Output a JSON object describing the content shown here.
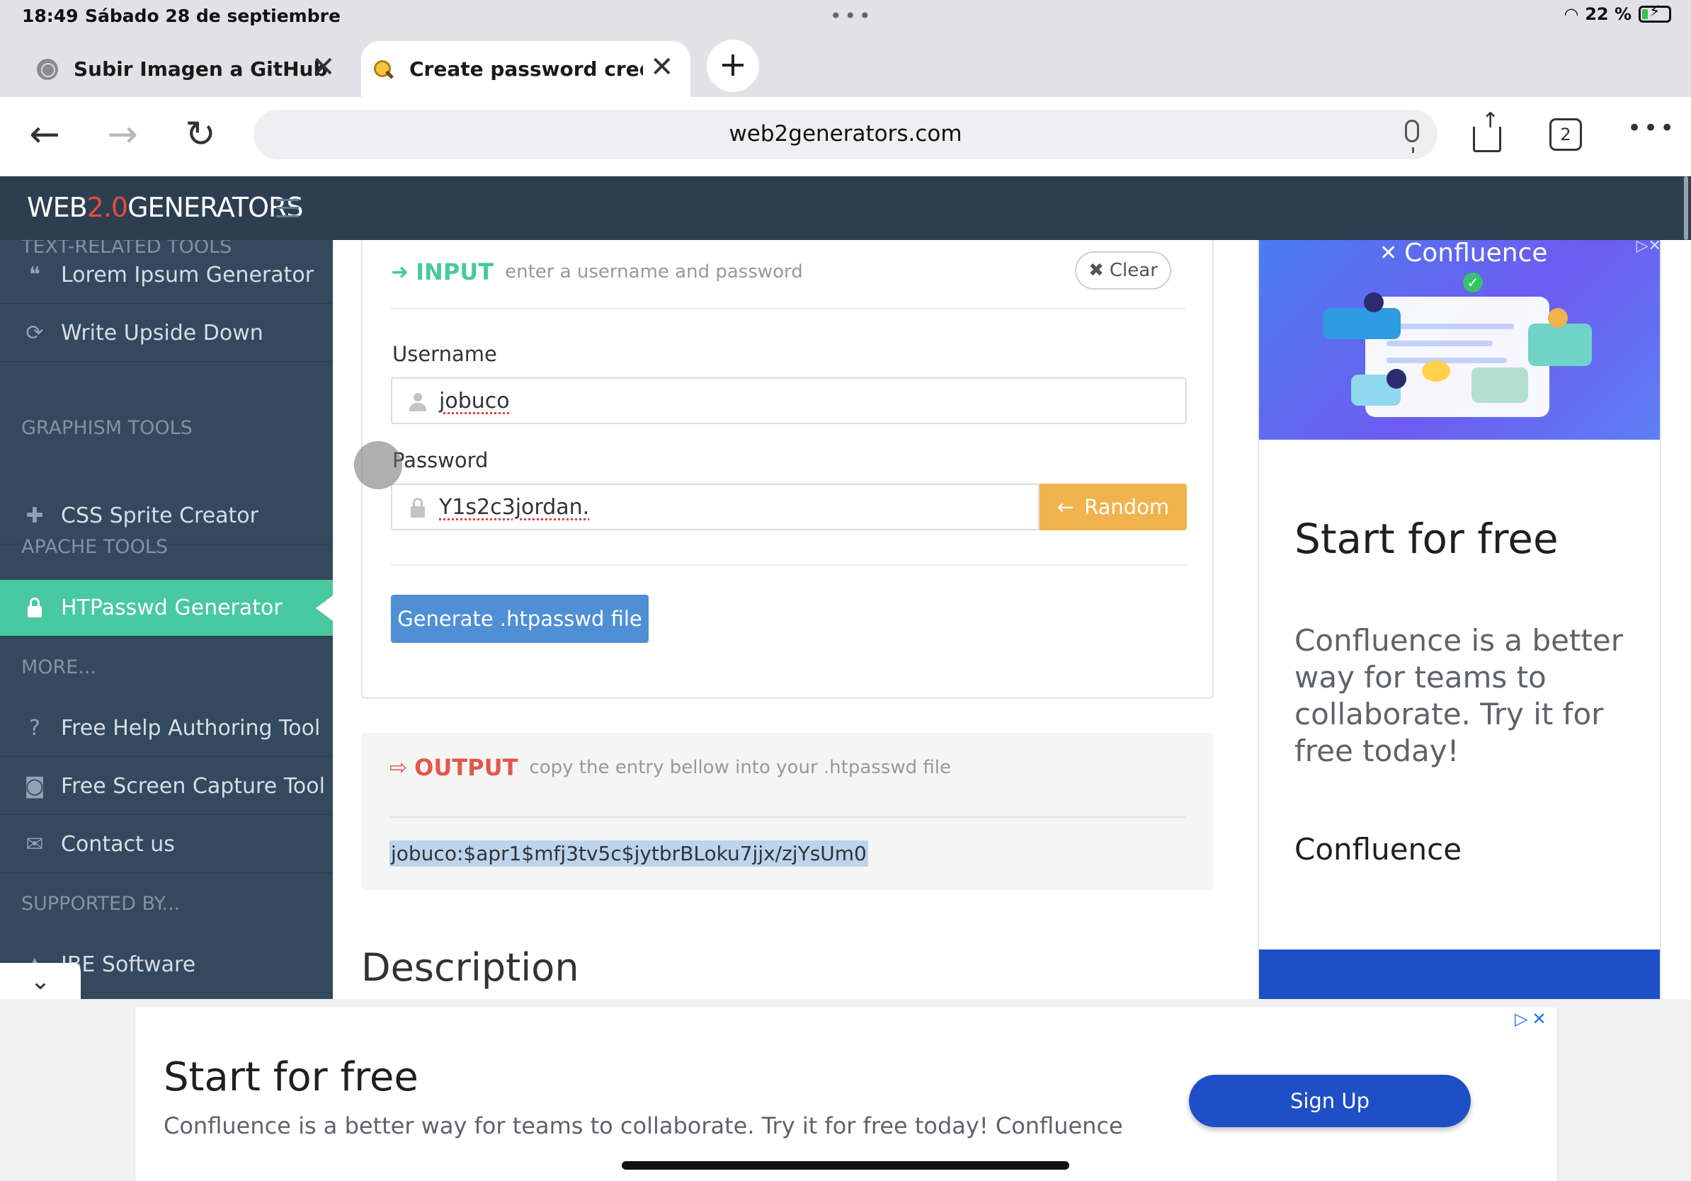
{
  "status_bar": {
    "time": "18:49",
    "date": "Sábado 28 de septiembre",
    "battery": "22 %"
  },
  "tabs": [
    {
      "title": "Subir Imagen a GitHub"
    },
    {
      "title": "Create password credentials"
    }
  ],
  "tabs_count": "2",
  "address_bar": {
    "url": "web2generators.com"
  },
  "site": {
    "logo_prefix": "WEB",
    "logo_version": "2.0",
    "logo_suffix": "GENERATORS"
  },
  "sidebar": {
    "headers": [
      "TEXT-RELATED TOOLS",
      "GRAPHISM TOOLS",
      "APACHE TOOLS",
      "MORE...",
      "SUPPORTED BY..."
    ],
    "items": [
      {
        "label": "Lorem Ipsum Generator",
        "icon": "quote-icon"
      },
      {
        "label": "Write Upside Down",
        "icon": "refresh-icon"
      },
      {
        "label": "CSS Sprite Creator",
        "icon": "puzzle-icon"
      },
      {
        "label": "HTPasswd Generator",
        "icon": "lock-icon",
        "active": true
      },
      {
        "label": "Free Help Authoring Tool",
        "icon": "question-icon"
      },
      {
        "label": "Free Screen Capture Tool",
        "icon": "camera-icon"
      },
      {
        "label": "Contact us",
        "icon": "envelope-icon"
      },
      {
        "label": "IBE Software",
        "icon": "ibe-icon"
      }
    ]
  },
  "input_panel": {
    "title": "INPUT",
    "subtitle": "enter a username and password",
    "clear_label": "Clear",
    "username_label": "Username",
    "username_value": "jobuco",
    "password_label": "Password",
    "password_value": "Y1s2c3jordan.",
    "random_label": "Random",
    "generate_label": "Generate .htpasswd file"
  },
  "output_panel": {
    "title": "OUTPUT",
    "subtitle": "copy the entry bellow into your .htpasswd file",
    "value": "jobuco:$apr1$mfj3tv5c$jytbrBLoku7jjx/zjYsUm0"
  },
  "description_heading": "Description",
  "side_ad": {
    "brand": "Confluence",
    "heading": "Start for free",
    "text": "Confluence is a better way for teams to collaborate. Try it for free today!",
    "company": "Confluence",
    "accent": "#1f4fc6"
  },
  "bottom_ad": {
    "heading": "Start for free",
    "text": "Confluence is a better way for teams to collaborate. Try it for free today! Confluence",
    "button_label": "Sign Up"
  },
  "colors": {
    "header_bg": "#2c3e50",
    "sidebar_bg": "#34495e",
    "active_item": "#48c9a0",
    "random_button": "#f0b34d",
    "generate_button": "#4f8fd6",
    "output_accent": "#e0584c"
  }
}
